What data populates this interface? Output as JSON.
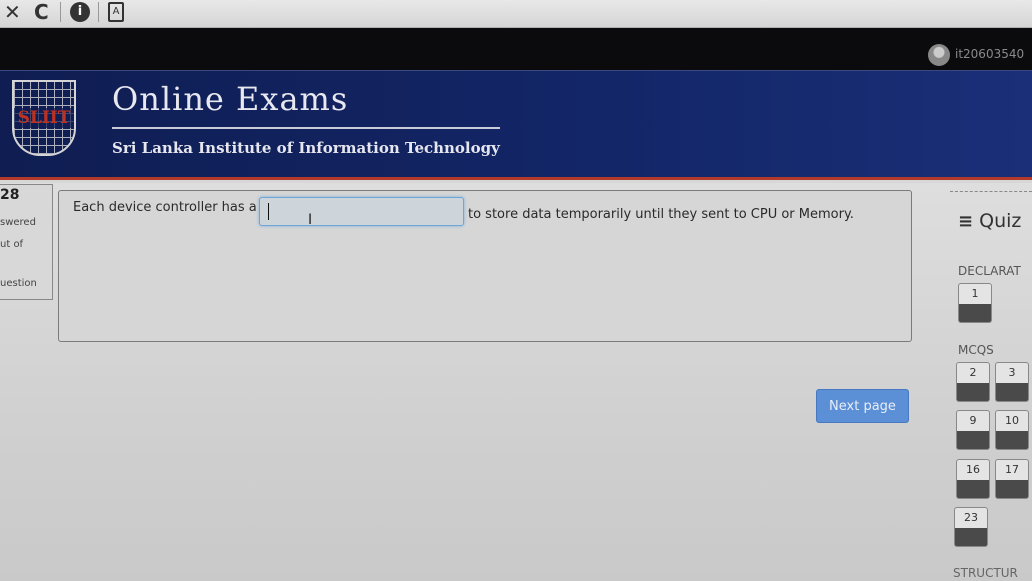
{
  "browser": {
    "close_glyph": "✕",
    "reload_glyph": "C",
    "info_glyph": "i",
    "doc_glyph": "A"
  },
  "user": {
    "id_label": "it20603540"
  },
  "header": {
    "logo_text": "SLIIT",
    "title": "Online Exams",
    "subtitle": "Sri Lanka Institute of Information Technology"
  },
  "question_info": {
    "number": "28",
    "state": "swered",
    "marks": "ut of",
    "flag": "uestion"
  },
  "question": {
    "text_before": "Each device controller has a",
    "answer_value": "",
    "text_after": "to store data temporarily until they sent to CPU or Memory."
  },
  "next_button": {
    "label": "Next page"
  },
  "quiz_nav": {
    "title": "Quiz",
    "menu_icon": "hamburger-icon",
    "sections": [
      {
        "name": "DECLARAT",
        "questions": [
          "1"
        ]
      },
      {
        "name": "MCQS",
        "questions": [
          "2",
          "3",
          "9",
          "10",
          "16",
          "17",
          "23"
        ]
      },
      {
        "name": "STRUCTUR",
        "questions": []
      }
    ]
  },
  "colors": {
    "banner": "#132668",
    "banner_border": "#b33a2a",
    "next_button": "#5b8fd6",
    "answer_focus": "#6fa6d6"
  }
}
